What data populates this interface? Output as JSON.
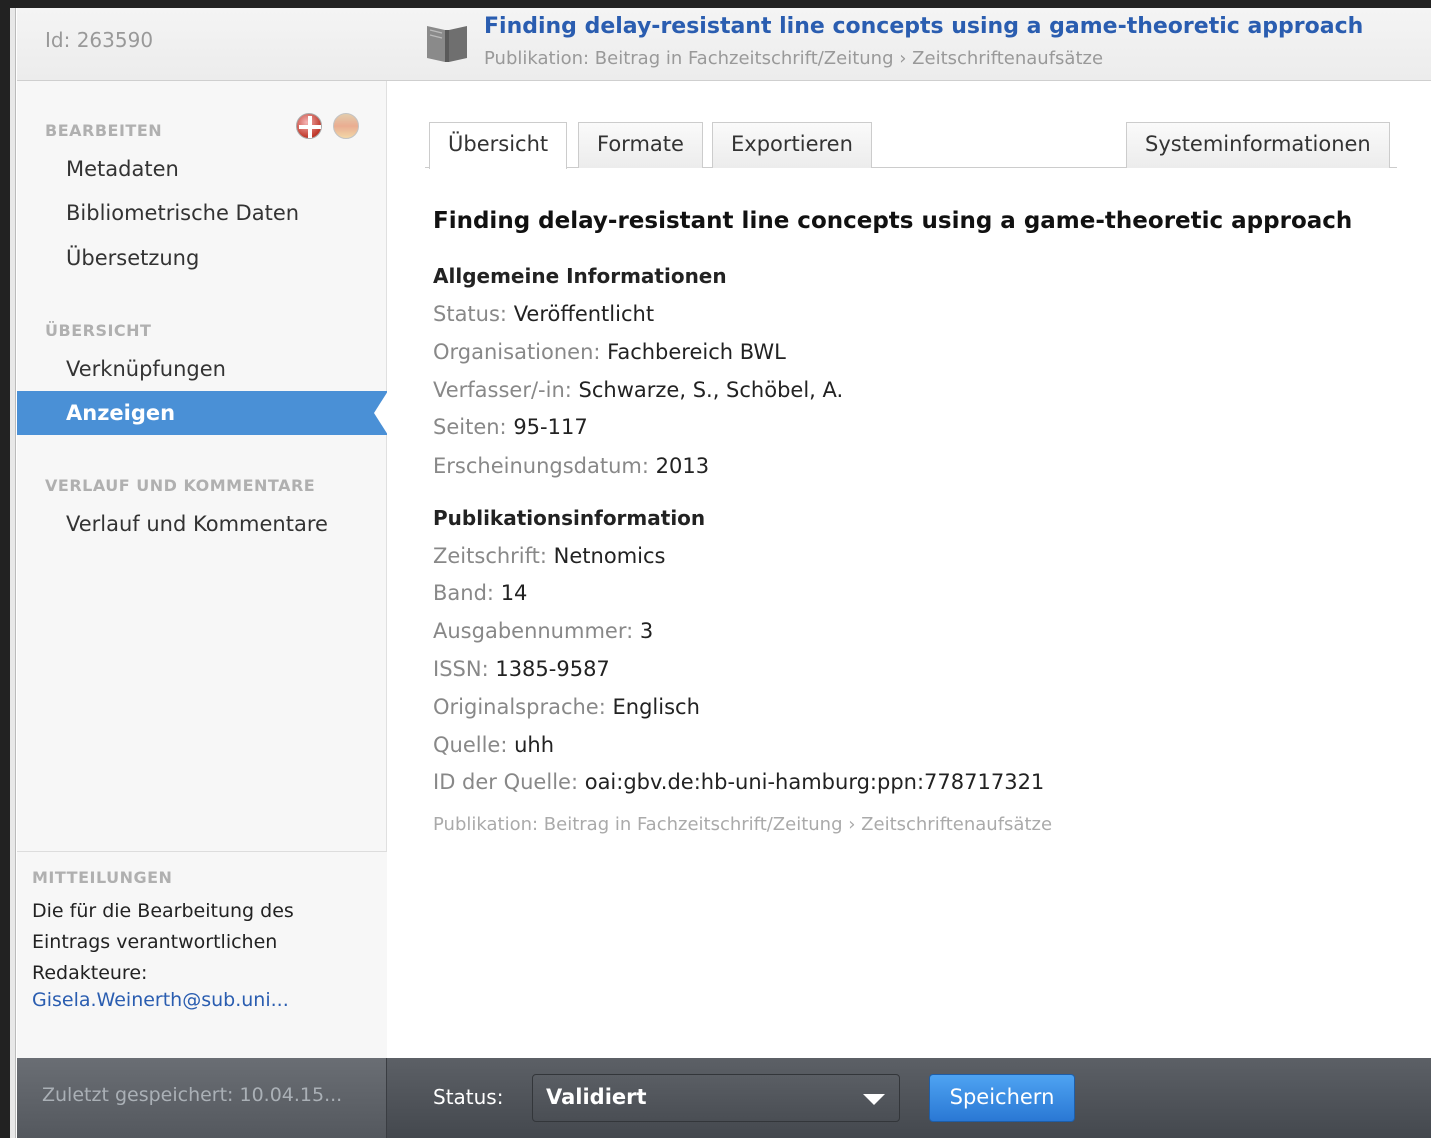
{
  "header": {
    "id_text": "Id: 263590",
    "title": "Finding delay-resistant line concepts using a game-theoretic approach",
    "breadcrumb": "Publikation: Beitrag in Fachzeitschrift/Zeitung › Zeitschriftenaufsätze",
    "icon": "book-icon"
  },
  "sidebar": {
    "sections": [
      {
        "title": "BEARBEITEN",
        "items": [
          "Metadaten",
          "Bibliometrische Daten",
          "Übersetzung"
        ]
      },
      {
        "title": "ÜBERSICHT",
        "items": [
          "Verknüpfungen",
          "Anzeigen"
        ]
      },
      {
        "title": "VERLAUF UND KOMMENTARE",
        "items": [
          "Verlauf und Kommentare"
        ]
      }
    ],
    "active_item": "Anzeigen",
    "flags": [
      "uk-flag-icon",
      "de-flag-icon"
    ],
    "messages": {
      "title": "MITTEILUNGEN",
      "text": "Die für die Bearbeitung des Eintrags verantwortlichen Redakteure:",
      "link": "Gisela.Weinerth@sub.uni..."
    }
  },
  "tabs": [
    {
      "label": "Übersicht",
      "active": true
    },
    {
      "label": "Formate",
      "active": false
    },
    {
      "label": "Exportieren",
      "active": false
    },
    {
      "label": "Systeminformationen",
      "active": false
    }
  ],
  "content": {
    "title": "Finding delay-resistant line concepts using a game-theoretic approach",
    "general_heading": "Allgemeine Informationen",
    "general": [
      {
        "label": "Status:",
        "value": "Veröffentlicht"
      },
      {
        "label": "Organisationen:",
        "value": "Fachbereich BWL"
      },
      {
        "label": "Verfasser/-in:",
        "value": "Schwarze, S., Schöbel, A."
      },
      {
        "label": "Seiten:",
        "value": "95-117"
      },
      {
        "label": "Erscheinungsdatum:",
        "value": "2013"
      }
    ],
    "pub_heading": "Publikationsinformation",
    "pub": [
      {
        "label": "Zeitschrift:",
        "value": "Netnomics"
      },
      {
        "label": "Band:",
        "value": "14"
      },
      {
        "label": "Ausgabennummer:",
        "value": "3"
      },
      {
        "label": "ISSN:",
        "value": "1385-9587"
      },
      {
        "label": "Originalsprache:",
        "value": "Englisch"
      },
      {
        "label": "Quelle:",
        "value": "uhh"
      },
      {
        "label": "ID der Quelle:",
        "value": "oai:gbv.de:hb-uni-hamburg:ppn:778717321"
      }
    ],
    "footer_breadcrumb": "Publikation: Beitrag in Fachzeitschrift/Zeitung › Zeitschriftenaufsätze"
  },
  "bottom": {
    "saved_text": "Zuletzt gespeichert: 10.04.15...",
    "status_label": "Status:",
    "status_value": "Validiert",
    "save_label": "Speichern"
  }
}
